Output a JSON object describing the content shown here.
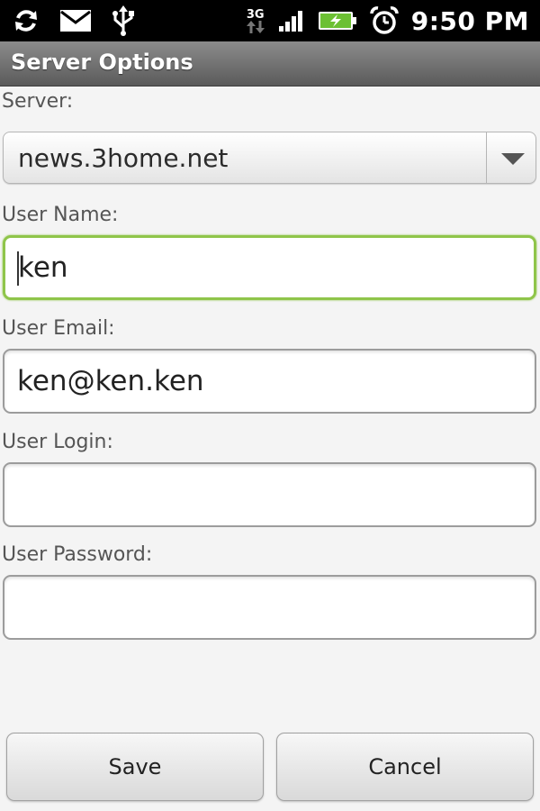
{
  "status_bar": {
    "time": "9:50 PM",
    "network_label": "3G",
    "icons": [
      "sync-icon",
      "mail-icon",
      "usb-icon",
      "network-3g-icon",
      "signal-icon",
      "battery-charging-icon",
      "alarm-clock-icon"
    ]
  },
  "title_bar": {
    "title": "Server Options"
  },
  "form": {
    "server": {
      "label": "Server:",
      "value": "news.3home.net"
    },
    "user_name": {
      "label": "User Name:",
      "value": "ken",
      "focused": true
    },
    "user_email": {
      "label": "User Email:",
      "value": "ken@ken.ken"
    },
    "user_login": {
      "label": "User Login:",
      "value": ""
    },
    "user_password": {
      "label": "User Password:",
      "value": ""
    }
  },
  "buttons": {
    "save": "Save",
    "cancel": "Cancel"
  },
  "colors": {
    "focus_border": "#8fc54a",
    "status_bar_bg": "#000000",
    "title_bar_bg": "#6e6e6e",
    "battery_fill": "#6cc033"
  }
}
